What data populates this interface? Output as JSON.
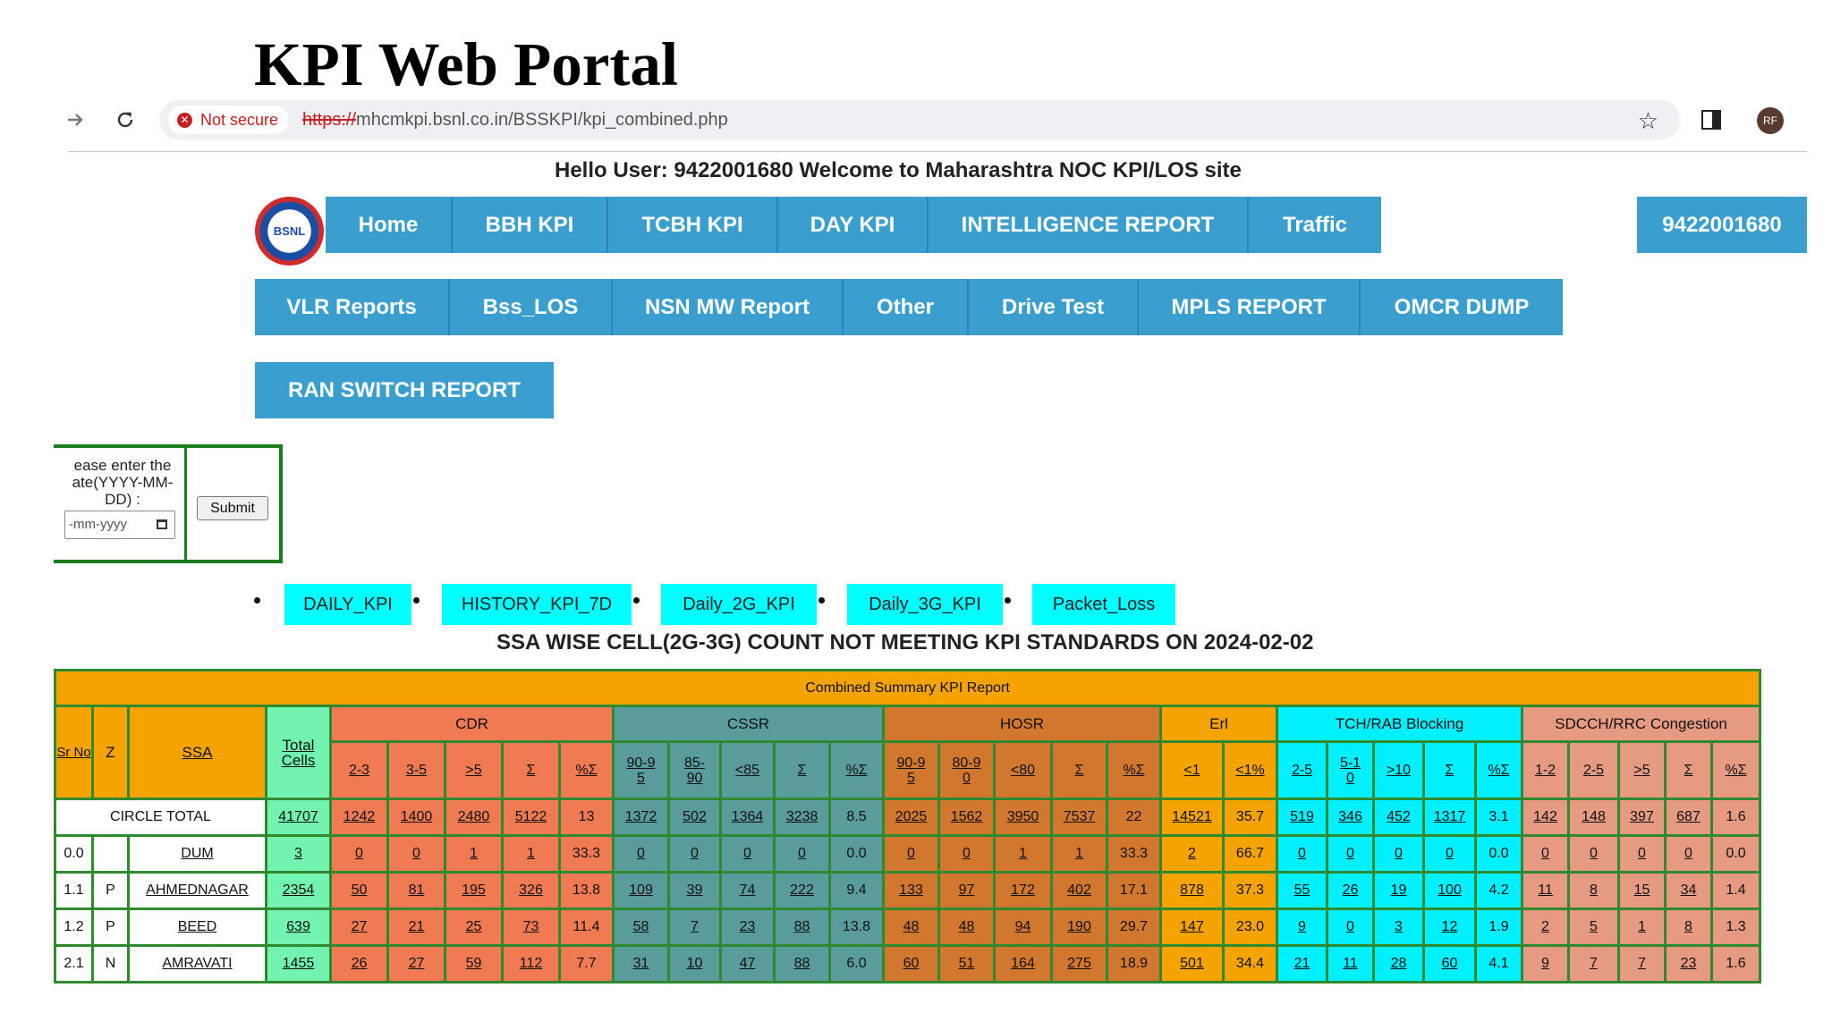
{
  "slide_title": "KPI Web Portal",
  "browser": {
    "security_label": "Not secure",
    "url_scheme": "https://",
    "url_rest": "mhcmkpi.bsnl.co.in/BSSKPI/kpi_combined.php",
    "avatar_initials": "RF"
  },
  "header": {
    "greeting": "Hello User:  9422001680   Welcome to Maharashtra NOC KPI/LOS site",
    "logo_text": "BSNL",
    "user_id": "9422001680"
  },
  "nav_row1": [
    "Home",
    "BBH KPI",
    "TCBH KPI",
    "DAY KPI",
    "INTELLIGENCE REPORT",
    "Traffic"
  ],
  "nav_row2": [
    "VLR Reports",
    "Bss_LOS",
    "NSN MW Report",
    "Other",
    "Drive Test",
    "MPLS REPORT",
    "OMCR DUMP"
  ],
  "nav_row3": [
    "RAN SWITCH REPORT"
  ],
  "date_form": {
    "prompt": "ease enter the ate(YYYY-MM-DD) :",
    "input_placeholder": "-mm-yyyy",
    "submit_label": "Submit"
  },
  "quick_links": [
    "DAILY_KPI",
    "HISTORY_KPI_7D",
    "Daily_2G_KPI",
    "Daily_3G_KPI",
    "Packet_Loss"
  ],
  "report_title": "SSA WISE CELL(2G-3G) COUNT NOT MEETING KPI STANDARDS ON  2024-02-02",
  "table": {
    "caption": "Combined Summary KPI Report",
    "key_headers": {
      "sr": "Sr No",
      "zone": "Z",
      "ssa": "SSA",
      "total": "Total Cells"
    },
    "groups": [
      {
        "name": "CDR",
        "cols": [
          "2-3",
          "3-5",
          ">5",
          "Σ",
          "%Σ"
        ]
      },
      {
        "name": "CSSR",
        "cols": [
          "90-95",
          "85-90",
          "<85",
          "Σ",
          "%Σ"
        ]
      },
      {
        "name": "HOSR",
        "cols": [
          "90-95",
          "80-90",
          "<80",
          "Σ",
          "%Σ"
        ]
      },
      {
        "name": "Erl",
        "cols": [
          "<1",
          "<1%"
        ]
      },
      {
        "name": "TCH/RAB Blocking",
        "cols": [
          "2-5",
          "5-10",
          ">10",
          "Σ",
          "%Σ"
        ]
      },
      {
        "name": "SDCCH/RRC Congestion",
        "cols": [
          "1-2",
          "2-5",
          ">5",
          "Σ",
          "%Σ"
        ]
      }
    ],
    "circle_total": {
      "label": "CIRCLE TOTAL",
      "total": "41707",
      "values": [
        "1242",
        "1400",
        "2480",
        "5122",
        "13",
        "1372",
        "502",
        "1364",
        "3238",
        "8.5",
        "2025",
        "1562",
        "3950",
        "7537",
        "22",
        "14521",
        "35.7",
        "519",
        "346",
        "452",
        "1317",
        "3.1",
        "142",
        "148",
        "397",
        "687",
        "1.6"
      ]
    },
    "rows": [
      {
        "sr": "0.0",
        "zone": "",
        "ssa": "DUM",
        "total": "3",
        "values": [
          "0",
          "0",
          "1",
          "1",
          "33.3",
          "0",
          "0",
          "0",
          "0",
          "0.0",
          "0",
          "0",
          "1",
          "1",
          "33.3",
          "2",
          "66.7",
          "0",
          "0",
          "0",
          "0",
          "0.0",
          "0",
          "0",
          "0",
          "0",
          "0.0"
        ]
      },
      {
        "sr": "1.1",
        "zone": "P",
        "ssa": "AHMEDNAGAR",
        "total": "2354",
        "values": [
          "50",
          "81",
          "195",
          "326",
          "13.8",
          "109",
          "39",
          "74",
          "222",
          "9.4",
          "133",
          "97",
          "172",
          "402",
          "17.1",
          "878",
          "37.3",
          "55",
          "26",
          "19",
          "100",
          "4.2",
          "11",
          "8",
          "15",
          "34",
          "1.4"
        ]
      },
      {
        "sr": "1.2",
        "zone": "P",
        "ssa": "BEED",
        "total": "639",
        "values": [
          "27",
          "21",
          "25",
          "73",
          "11.4",
          "58",
          "7",
          "23",
          "88",
          "13.8",
          "48",
          "48",
          "94",
          "190",
          "29.7",
          "147",
          "23.0",
          "9",
          "0",
          "3",
          "12",
          "1.9",
          "2",
          "5",
          "1",
          "8",
          "1.3"
        ]
      },
      {
        "sr": "2.1",
        "zone": "N",
        "ssa": "AMRAVATI",
        "total": "1455",
        "values": [
          "26",
          "27",
          "59",
          "112",
          "7.7",
          "31",
          "10",
          "47",
          "88",
          "6.0",
          "60",
          "51",
          "164",
          "275",
          "18.9",
          "501",
          "34.4",
          "21",
          "11",
          "28",
          "60",
          "4.1",
          "9",
          "7",
          "7",
          "23",
          "1.6"
        ]
      }
    ]
  }
}
